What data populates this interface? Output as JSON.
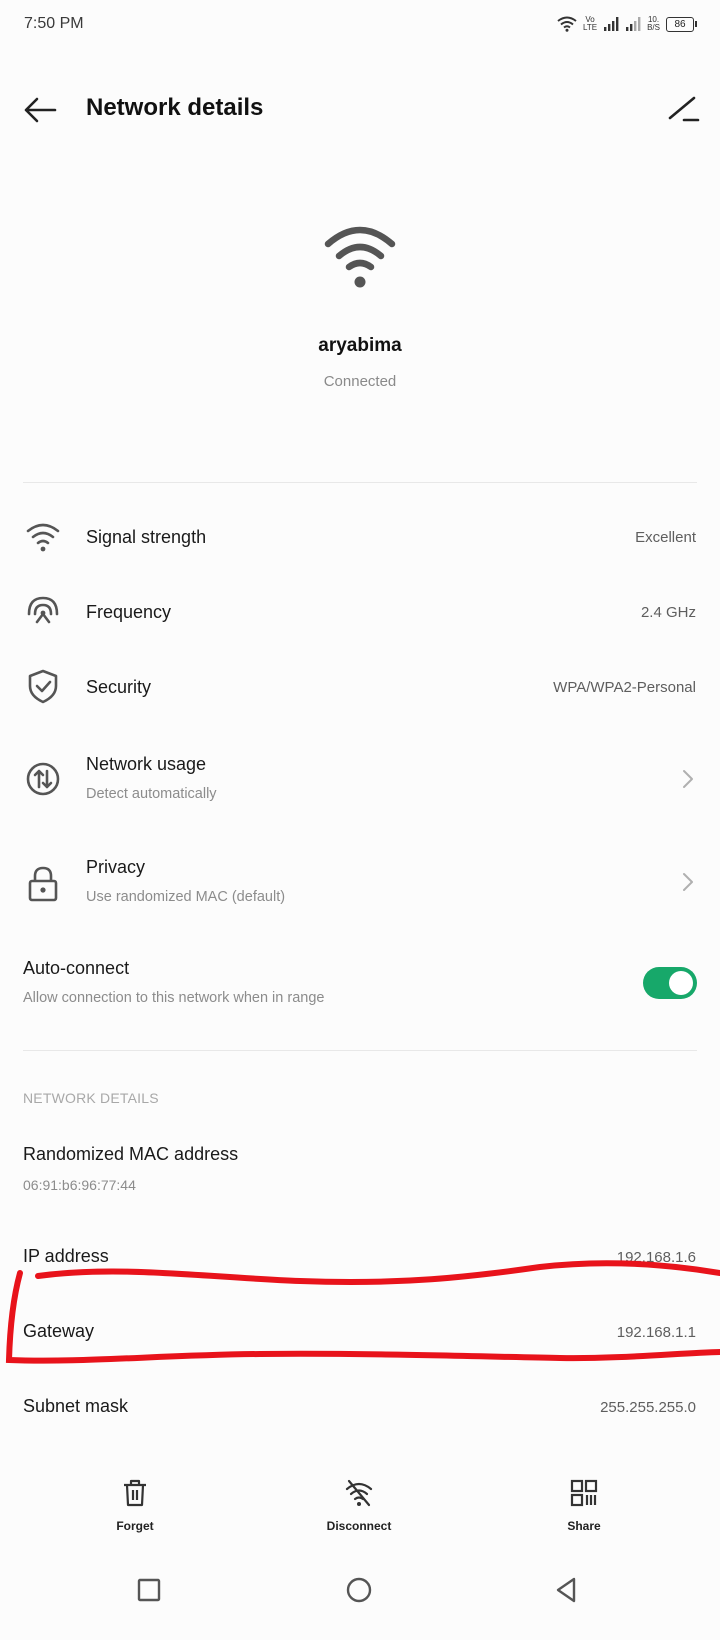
{
  "status_bar": {
    "time": "7:50 PM",
    "volte_top": "Vo",
    "volte_bottom": "LTE",
    "speed_top": "10.",
    "speed_bottom": "B/S",
    "battery": "86"
  },
  "header": {
    "title": "Network details"
  },
  "network": {
    "name": "aryabima",
    "status": "Connected"
  },
  "rows": [
    {
      "label": "Signal strength",
      "value": "Excellent",
      "icon": "wifi-signal-icon"
    },
    {
      "label": "Frequency",
      "value": "2.4 GHz",
      "icon": "frequency-icon"
    },
    {
      "label": "Security",
      "value": "WPA/WPA2-Personal",
      "icon": "shield-check-icon"
    },
    {
      "label": "Network usage",
      "sub": "Detect automatically",
      "icon": "data-usage-icon"
    },
    {
      "label": "Privacy",
      "sub": "Use randomized MAC (default)",
      "icon": "lock-icon"
    }
  ],
  "auto_connect": {
    "label": "Auto-connect",
    "sub": "Allow connection to this network when in range",
    "enabled": true
  },
  "details": {
    "section_title": "NETWORK DETAILS",
    "mac_label": "Randomized MAC address",
    "mac_value": "06:91:b6:96:77:44",
    "ip_label": "IP address",
    "ip_value": "192.168.1.6",
    "gateway_label": "Gateway",
    "gateway_value": "192.168.1.1",
    "subnet_label": "Subnet mask",
    "subnet_value": "255.255.255.0"
  },
  "actions": {
    "forget": "Forget",
    "disconnect": "Disconnect",
    "share": "Share"
  },
  "colors": {
    "accent_green": "#17a86a",
    "annotation_red": "#e8131b"
  }
}
